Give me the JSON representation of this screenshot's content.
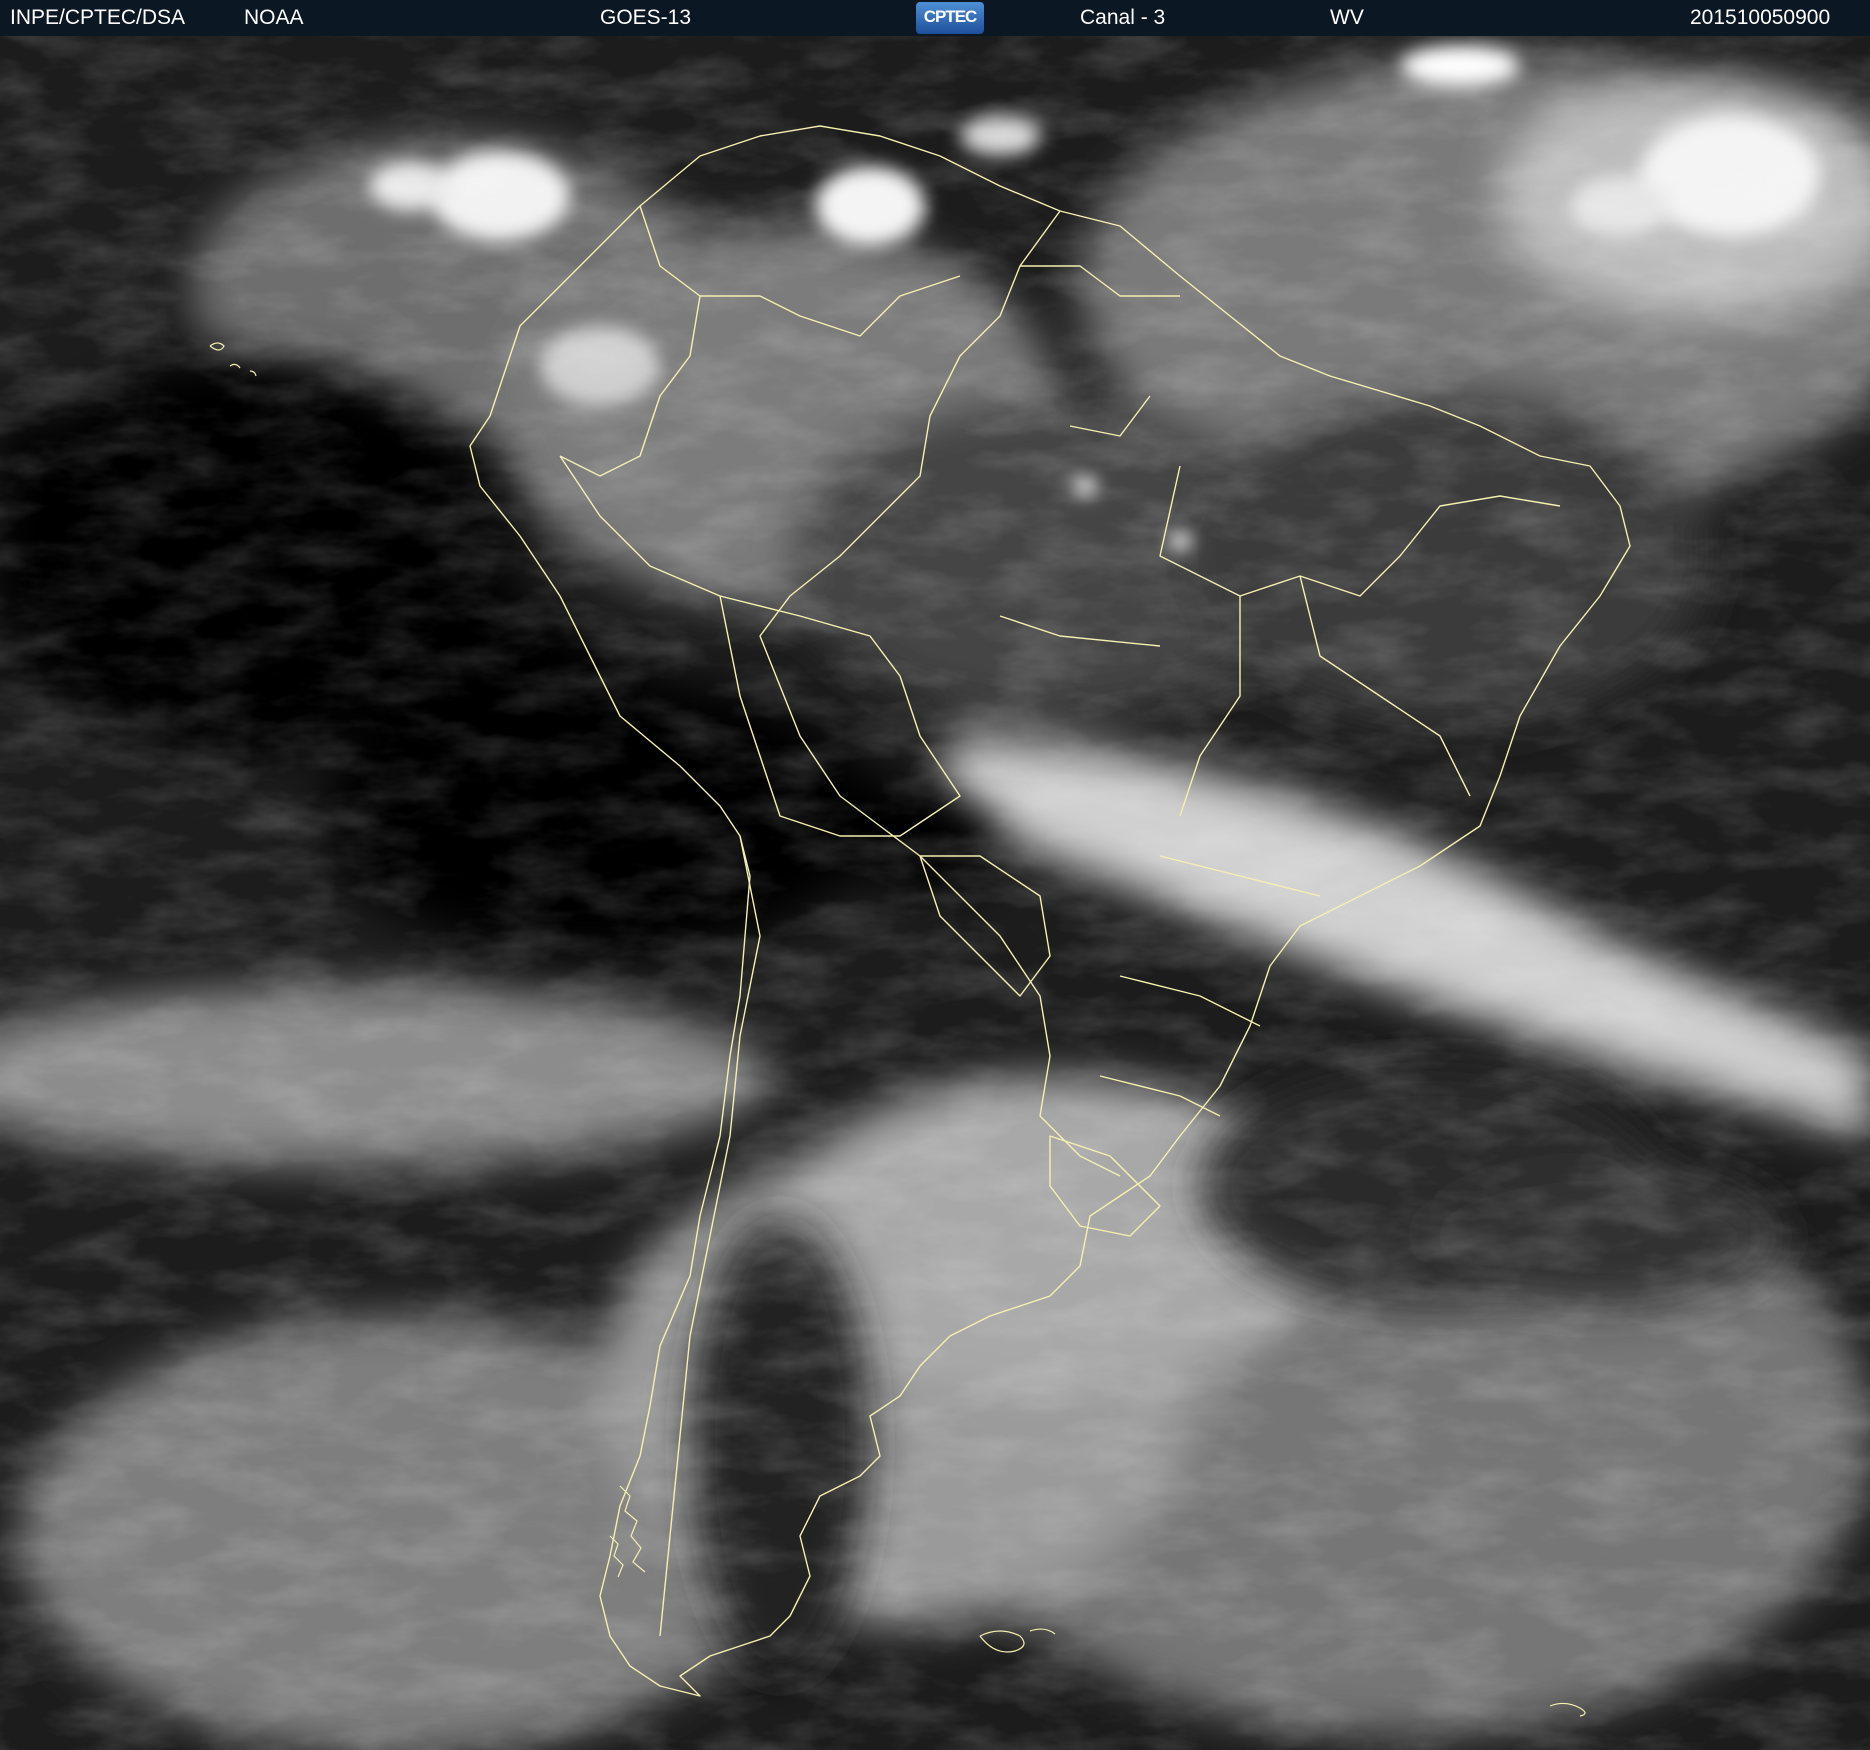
{
  "header": {
    "organization": "INPE/CPTEC/DSA",
    "agency": "NOAA",
    "satellite": "GOES-13",
    "logo_text": "CPTEC",
    "channel": "Canal - 3",
    "band": "WV",
    "timestamp": "201510050900"
  },
  "map": {
    "type": "water-vapor satellite image",
    "region": "South America",
    "palette": "grayscale",
    "border_color": "#f4f0b0"
  }
}
